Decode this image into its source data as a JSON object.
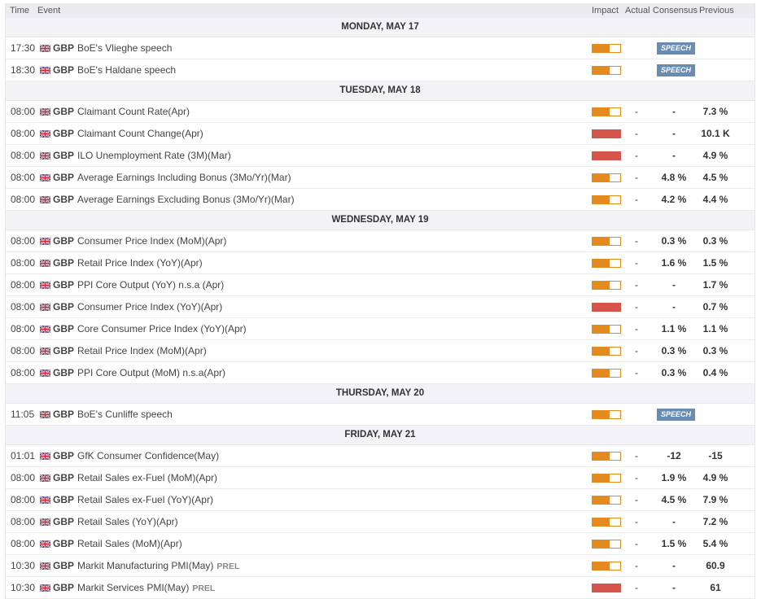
{
  "header": {
    "time": "Time",
    "event": "Event",
    "impact": "Impact",
    "actual": "Actual",
    "consensus": "Consensus",
    "previous": "Previous"
  },
  "colors": {
    "medium": "#e58a1e",
    "high": "#d6554a",
    "speech": "#6a8cb0"
  },
  "days": [
    {
      "label": "MONDAY, MAY 17",
      "events": [
        {
          "time": "17:30",
          "currency": "GBP",
          "event": "BoE's Vlieghe speech",
          "impact": "medium",
          "speech": "SPEECH"
        },
        {
          "time": "18:30",
          "currency": "GBP",
          "event": "BoE's Haldane speech",
          "impact": "medium",
          "speech": "SPEECH"
        }
      ]
    },
    {
      "label": "TUESDAY, MAY 18",
      "events": [
        {
          "time": "08:00",
          "currency": "GBP",
          "event": "Claimant Count Rate(Apr)",
          "impact": "medium",
          "actual": "-",
          "consensus": "-",
          "previous": "7.3 %"
        },
        {
          "time": "08:00",
          "currency": "GBP",
          "event": "Claimant Count Change(Apr)",
          "impact": "high",
          "actual": "-",
          "consensus": "-",
          "previous": "10.1 K"
        },
        {
          "time": "08:00",
          "currency": "GBP",
          "event": "ILO Unemployment Rate (3M)(Mar)",
          "impact": "high",
          "actual": "-",
          "consensus": "-",
          "previous": "4.9 %"
        },
        {
          "time": "08:00",
          "currency": "GBP",
          "event": "Average Earnings Including Bonus (3Mo/Yr)(Mar)",
          "impact": "medium",
          "actual": "-",
          "consensus": "4.8 %",
          "previous": "4.5 %"
        },
        {
          "time": "08:00",
          "currency": "GBP",
          "event": "Average Earnings Excluding Bonus (3Mo/Yr)(Mar)",
          "impact": "medium",
          "actual": "-",
          "consensus": "4.2 %",
          "previous": "4.4 %"
        }
      ]
    },
    {
      "label": "WEDNESDAY, MAY 19",
      "events": [
        {
          "time": "08:00",
          "currency": "GBP",
          "event": "Consumer Price Index (MoM)(Apr)",
          "impact": "medium",
          "actual": "-",
          "consensus": "0.3 %",
          "previous": "0.3 %"
        },
        {
          "time": "08:00",
          "currency": "GBP",
          "event": "Retail Price Index (YoY)(Apr)",
          "impact": "medium",
          "actual": "-",
          "consensus": "1.6 %",
          "previous": "1.5 %"
        },
        {
          "time": "08:00",
          "currency": "GBP",
          "event": "PPI Core Output (YoY) n.s.a (Apr)",
          "impact": "medium",
          "actual": "-",
          "consensus": "-",
          "previous": "1.7 %"
        },
        {
          "time": "08:00",
          "currency": "GBP",
          "event": "Consumer Price Index (YoY)(Apr)",
          "impact": "high",
          "actual": "-",
          "consensus": "-",
          "previous": "0.7 %"
        },
        {
          "time": "08:00",
          "currency": "GBP",
          "event": "Core Consumer Price Index (YoY)(Apr)",
          "impact": "medium",
          "actual": "-",
          "consensus": "1.1 %",
          "previous": "1.1 %"
        },
        {
          "time": "08:00",
          "currency": "GBP",
          "event": "Retail Price Index (MoM)(Apr)",
          "impact": "medium",
          "actual": "-",
          "consensus": "0.3 %",
          "previous": "0.3 %"
        },
        {
          "time": "08:00",
          "currency": "GBP",
          "event": "PPI Core Output (MoM) n.s.a(Apr)",
          "impact": "medium",
          "actual": "-",
          "consensus": "0.3 %",
          "previous": "0.4 %"
        }
      ]
    },
    {
      "label": "THURSDAY, MAY 20",
      "events": [
        {
          "time": "11:05",
          "currency": "GBP",
          "event": "BoE's Cunliffe speech",
          "impact": "medium",
          "speech": "SPEECH"
        }
      ]
    },
    {
      "label": "FRIDAY, MAY 21",
      "events": [
        {
          "time": "01:01",
          "currency": "GBP",
          "event": "GfK Consumer Confidence(May)",
          "impact": "medium",
          "actual": "-",
          "consensus": "-12",
          "previous": "-15"
        },
        {
          "time": "08:00",
          "currency": "GBP",
          "event": "Retail Sales ex-Fuel (MoM)(Apr)",
          "impact": "medium",
          "actual": "-",
          "consensus": "1.9 %",
          "previous": "4.9 %"
        },
        {
          "time": "08:00",
          "currency": "GBP",
          "event": "Retail Sales ex-Fuel (YoY)(Apr)",
          "impact": "medium",
          "actual": "-",
          "consensus": "4.5 %",
          "previous": "7.9 %"
        },
        {
          "time": "08:00",
          "currency": "GBP",
          "event": "Retail Sales (YoY)(Apr)",
          "impact": "medium",
          "actual": "-",
          "consensus": "-",
          "previous": "7.2 %"
        },
        {
          "time": "08:00",
          "currency": "GBP",
          "event": "Retail Sales (MoM)(Apr)",
          "impact": "medium",
          "actual": "-",
          "consensus": "1.5 %",
          "previous": "5.4 %"
        },
        {
          "time": "10:30",
          "currency": "GBP",
          "event": "Markit Manufacturing PMI(May)",
          "tag": "PREL",
          "impact": "medium",
          "actual": "-",
          "consensus": "-",
          "previous": "60.9"
        },
        {
          "time": "10:30",
          "currency": "GBP",
          "event": "Markit Services PMI(May)",
          "tag": "PREL",
          "impact": "high",
          "actual": "-",
          "consensus": "-",
          "previous": "61"
        }
      ]
    }
  ]
}
